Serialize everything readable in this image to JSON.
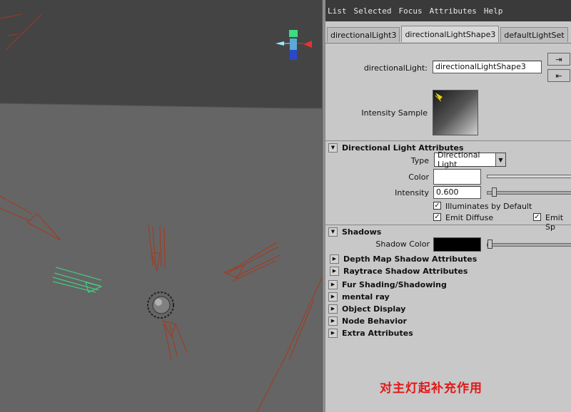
{
  "menu": [
    "List",
    "Selected",
    "Focus",
    "Attributes",
    "Help"
  ],
  "tabs": [
    "directionalLight3",
    "directionalLightShape3",
    "defaultLightSet"
  ],
  "active_tab": 1,
  "node": {
    "label": "directionalLight:",
    "value": "directionalLightShape3"
  },
  "intensity_sample_label": "Intensity Sample",
  "directional": {
    "header": "Directional Light Attributes",
    "type_label": "Type",
    "type_value": "Directional Light",
    "color_label": "Color",
    "color_value": "#ffffff",
    "intensity_label": "Intensity",
    "intensity_value": "0.600",
    "illuminates": "Illuminates by Default",
    "emit_diffuse": "Emit Diffuse",
    "emit_specular": "Emit Sp"
  },
  "shadows": {
    "header": "Shadows",
    "color_label": "Shadow Color",
    "color_value": "#000000"
  },
  "sections": [
    "Depth Map Shadow Attributes",
    "Raytrace Shadow Attributes",
    "Fur Shading/Shadowing",
    "mental ray",
    "Object Display",
    "Node Behavior",
    "Extra Attributes"
  ],
  "annotation": {
    "text": "对主灯起补充作用",
    "color": "#e01818"
  },
  "colors": {
    "viewport": "#656565",
    "viewport_top": "#444444",
    "light_lines": "#a8381c",
    "selected_light": "#3ddc84"
  }
}
